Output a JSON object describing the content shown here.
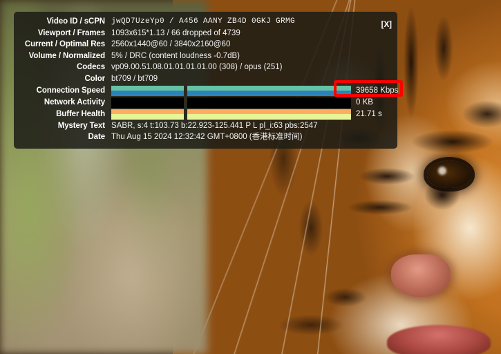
{
  "video": {
    "description": "close-up of a tiger's face with blurred green foliage at left"
  },
  "stats_panel": {
    "close_label": "[X]",
    "rows": [
      {
        "label": "Video ID / sCPN",
        "value": "jwQD7UzeYp0  /  A456 AANY ZB4D 0GKJ GRMG",
        "mono": true
      },
      {
        "label": "Viewport / Frames",
        "value": "1093x615*1.13 / 66 dropped of 4739"
      },
      {
        "label": "Current / Optimal Res",
        "value": "2560x1440@60 / 3840x2160@60"
      },
      {
        "label": "Volume / Normalized",
        "value": "5% / DRC (content loudness -0.7dB)"
      },
      {
        "label": "Codecs",
        "value": "vp09.00.51.08.01.01.01.01.00 (308) / opus (251)"
      },
      {
        "label": "Color",
        "value": "bt709 / bt709"
      }
    ],
    "graphs": [
      {
        "label": "Connection Speed",
        "readout": "39658 Kbps",
        "color_top": "#66c2a5",
        "color_bottom": "#2b83ba",
        "fill_a": 100,
        "fill_b": 100
      },
      {
        "label": "Network Activity",
        "readout": "0 KB",
        "color_top": "#000000",
        "color_bottom": "#000000",
        "fill_a": 100,
        "fill_b": 100
      },
      {
        "label": "Buffer Health",
        "readout": "21.71 s",
        "color_top": "#fdae61",
        "color_bottom": "#e6f598",
        "fill_a": 100,
        "fill_b": 100
      }
    ],
    "footer_rows": [
      {
        "label": "Mystery Text",
        "value": "SABR, s:4 t:103.73 b:22.923-125.441 P L pl_i:63 pbs:2547"
      },
      {
        "label": "Date",
        "value": "Thu Aug 15 2024 12:32:42 GMT+0800 (香港标准时间)"
      }
    ]
  },
  "annotation": {
    "highlight_color": "#ff0000",
    "highlights": "39658 Kbps"
  }
}
